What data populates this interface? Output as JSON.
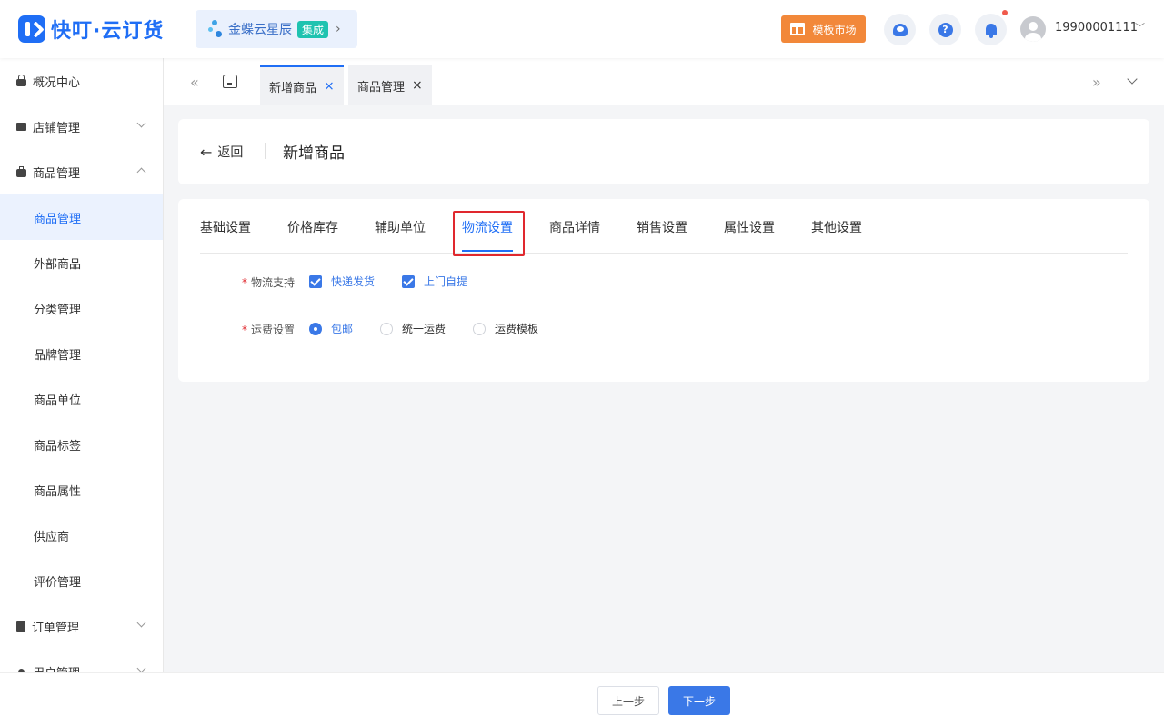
{
  "header": {
    "logo_text": "快叮·云订货",
    "brand_name": "金蝶云星辰",
    "brand_badge": "集成",
    "template_market": "模板市场",
    "user_phone": "19900001111",
    "accent_color": "#1f6ef5",
    "orange_color": "#f2883a"
  },
  "sidebar": {
    "items": [
      {
        "label": "概况中心",
        "icon": "lock-icon"
      },
      {
        "label": "店铺管理",
        "icon": "store-icon"
      },
      {
        "label": "商品管理",
        "icon": "bag-icon"
      },
      {
        "label": "商品管理"
      },
      {
        "label": "外部商品"
      },
      {
        "label": "分类管理"
      },
      {
        "label": "品牌管理"
      },
      {
        "label": "商品单位"
      },
      {
        "label": "商品标签"
      },
      {
        "label": "商品属性"
      },
      {
        "label": "供应商"
      },
      {
        "label": "评价管理"
      },
      {
        "label": "订单管理",
        "icon": "clipboard-icon"
      },
      {
        "label": "用户管理",
        "icon": "user-icon"
      }
    ]
  },
  "tabs_bar": {
    "tabs": [
      {
        "label": "新增商品",
        "close": "×"
      },
      {
        "label": "商品管理",
        "close": "×"
      }
    ]
  },
  "page": {
    "back_label": "返回",
    "title": "新增商品"
  },
  "form": {
    "tabs": [
      "基础设置",
      "价格库存",
      "辅助单位",
      "物流设置",
      "商品详情",
      "销售设置",
      "属性设置",
      "其他设置"
    ],
    "active_tab": "物流设置",
    "logistics": {
      "label": "物流支持",
      "required_mark": "*",
      "options": [
        {
          "label": "快递发货",
          "checked": true
        },
        {
          "label": "上门自提",
          "checked": true
        }
      ]
    },
    "shipping": {
      "label": "运费设置",
      "required_mark": "*",
      "options": [
        {
          "label": "包邮",
          "selected": true
        },
        {
          "label": "统一运费",
          "selected": false
        },
        {
          "label": "运费模板",
          "selected": false
        }
      ]
    }
  },
  "footer": {
    "prev_label": "上一步",
    "next_label": "下一步"
  }
}
